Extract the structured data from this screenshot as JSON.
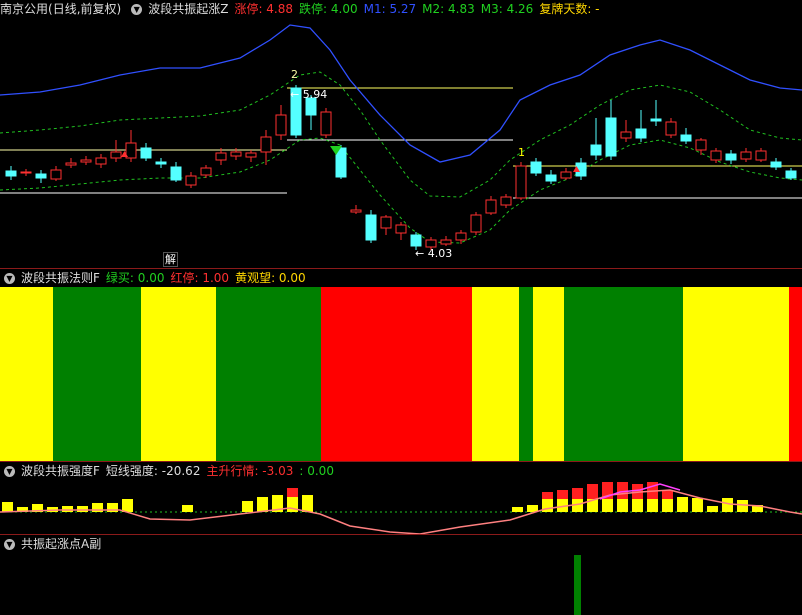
{
  "main_panel": {
    "stock_label": "南京公用",
    "period_label": "(日线,前复权)",
    "indicator_name": "波段共振起涨Z",
    "items": [
      {
        "label": "涨停:",
        "value": "4.88",
        "color": "#ff3030"
      },
      {
        "label": "跌停:",
        "value": "4.00",
        "color": "#20d020"
      },
      {
        "label": "M1:",
        "value": "5.27",
        "color": "#3050ff"
      },
      {
        "label": "M2:",
        "value": "4.83",
        "color": "#20d020"
      },
      {
        "label": "M3:",
        "value": "4.26",
        "color": "#20d020"
      },
      {
        "label": "复牌天数:",
        "value": "-",
        "color": "#ffd700"
      }
    ],
    "annotations": {
      "wave_label_2": "2",
      "wave_label_1": "1",
      "high_price": "5.94",
      "low_price": "4.03",
      "event_badge": "解"
    }
  },
  "panel2": {
    "indicator_name": "波段共振法则F",
    "items": [
      {
        "label": "绿买:",
        "value": "0.00",
        "color": "#20d020"
      },
      {
        "label": "红停:",
        "value": "1.00",
        "color": "#ff3030"
      },
      {
        "label": "黄观望:",
        "value": "0.00",
        "color": "#ffd700"
      }
    ],
    "bands": [
      {
        "state": "yellow",
        "width": 53
      },
      {
        "state": "green",
        "width": 88
      },
      {
        "state": "yellow",
        "width": 75
      },
      {
        "state": "green",
        "width": 105
      },
      {
        "state": "red",
        "width": 151
      },
      {
        "state": "yellow",
        "width": 47
      },
      {
        "state": "green",
        "width": 14
      },
      {
        "state": "yellow",
        "width": 31
      },
      {
        "state": "green",
        "width": 119
      },
      {
        "state": "yellow",
        "width": 106
      },
      {
        "state": "red",
        "width": 13
      }
    ]
  },
  "panel3": {
    "indicator_name": "波段共振强度F",
    "items": [
      {
        "label": "短线强度:",
        "value": "-20.62",
        "color": "#dddddd"
      },
      {
        "label": "主升行情:",
        "value": "-3.03",
        "color": "#ff3030"
      },
      {
        "label": ":",
        "value": "0.00",
        "color": "#20d020"
      }
    ]
  },
  "panel4": {
    "indicator_name": "共振起涨点A副"
  },
  "colors": {
    "up": "#ff3030",
    "down": "#54ffff",
    "yellow": "#ffff00",
    "green": "#008000",
    "red": "#ff0000",
    "m1": "#3050ff",
    "ma": "#20c020"
  }
}
